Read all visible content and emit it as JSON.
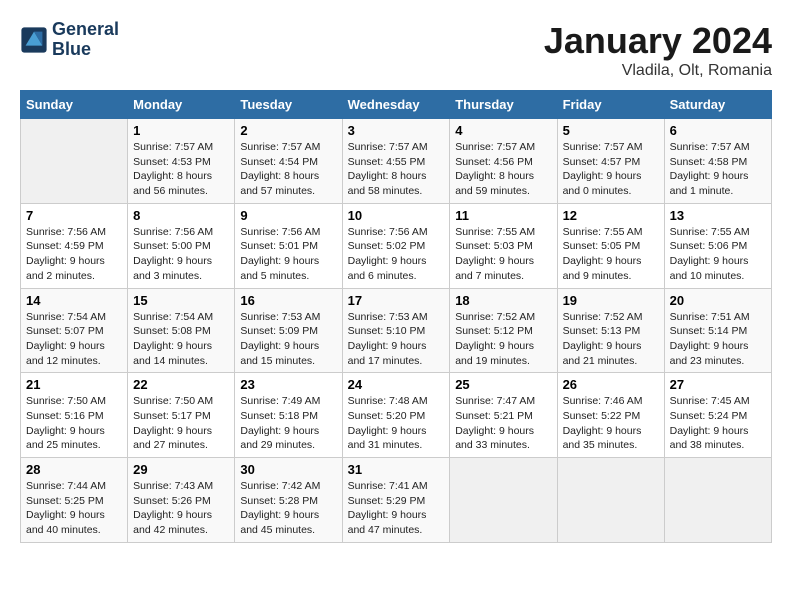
{
  "header": {
    "logo_line1": "General",
    "logo_line2": "Blue",
    "month": "January 2024",
    "location": "Vladila, Olt, Romania"
  },
  "weekdays": [
    "Sunday",
    "Monday",
    "Tuesday",
    "Wednesday",
    "Thursday",
    "Friday",
    "Saturday"
  ],
  "weeks": [
    [
      {
        "day": "",
        "info": ""
      },
      {
        "day": "1",
        "info": "Sunrise: 7:57 AM\nSunset: 4:53 PM\nDaylight: 8 hours\nand 56 minutes."
      },
      {
        "day": "2",
        "info": "Sunrise: 7:57 AM\nSunset: 4:54 PM\nDaylight: 8 hours\nand 57 minutes."
      },
      {
        "day": "3",
        "info": "Sunrise: 7:57 AM\nSunset: 4:55 PM\nDaylight: 8 hours\nand 58 minutes."
      },
      {
        "day": "4",
        "info": "Sunrise: 7:57 AM\nSunset: 4:56 PM\nDaylight: 8 hours\nand 59 minutes."
      },
      {
        "day": "5",
        "info": "Sunrise: 7:57 AM\nSunset: 4:57 PM\nDaylight: 9 hours\nand 0 minutes."
      },
      {
        "day": "6",
        "info": "Sunrise: 7:57 AM\nSunset: 4:58 PM\nDaylight: 9 hours\nand 1 minute."
      }
    ],
    [
      {
        "day": "7",
        "info": "Sunrise: 7:56 AM\nSunset: 4:59 PM\nDaylight: 9 hours\nand 2 minutes."
      },
      {
        "day": "8",
        "info": "Sunrise: 7:56 AM\nSunset: 5:00 PM\nDaylight: 9 hours\nand 3 minutes."
      },
      {
        "day": "9",
        "info": "Sunrise: 7:56 AM\nSunset: 5:01 PM\nDaylight: 9 hours\nand 5 minutes."
      },
      {
        "day": "10",
        "info": "Sunrise: 7:56 AM\nSunset: 5:02 PM\nDaylight: 9 hours\nand 6 minutes."
      },
      {
        "day": "11",
        "info": "Sunrise: 7:55 AM\nSunset: 5:03 PM\nDaylight: 9 hours\nand 7 minutes."
      },
      {
        "day": "12",
        "info": "Sunrise: 7:55 AM\nSunset: 5:05 PM\nDaylight: 9 hours\nand 9 minutes."
      },
      {
        "day": "13",
        "info": "Sunrise: 7:55 AM\nSunset: 5:06 PM\nDaylight: 9 hours\nand 10 minutes."
      }
    ],
    [
      {
        "day": "14",
        "info": "Sunrise: 7:54 AM\nSunset: 5:07 PM\nDaylight: 9 hours\nand 12 minutes."
      },
      {
        "day": "15",
        "info": "Sunrise: 7:54 AM\nSunset: 5:08 PM\nDaylight: 9 hours\nand 14 minutes."
      },
      {
        "day": "16",
        "info": "Sunrise: 7:53 AM\nSunset: 5:09 PM\nDaylight: 9 hours\nand 15 minutes."
      },
      {
        "day": "17",
        "info": "Sunrise: 7:53 AM\nSunset: 5:10 PM\nDaylight: 9 hours\nand 17 minutes."
      },
      {
        "day": "18",
        "info": "Sunrise: 7:52 AM\nSunset: 5:12 PM\nDaylight: 9 hours\nand 19 minutes."
      },
      {
        "day": "19",
        "info": "Sunrise: 7:52 AM\nSunset: 5:13 PM\nDaylight: 9 hours\nand 21 minutes."
      },
      {
        "day": "20",
        "info": "Sunrise: 7:51 AM\nSunset: 5:14 PM\nDaylight: 9 hours\nand 23 minutes."
      }
    ],
    [
      {
        "day": "21",
        "info": "Sunrise: 7:50 AM\nSunset: 5:16 PM\nDaylight: 9 hours\nand 25 minutes."
      },
      {
        "day": "22",
        "info": "Sunrise: 7:50 AM\nSunset: 5:17 PM\nDaylight: 9 hours\nand 27 minutes."
      },
      {
        "day": "23",
        "info": "Sunrise: 7:49 AM\nSunset: 5:18 PM\nDaylight: 9 hours\nand 29 minutes."
      },
      {
        "day": "24",
        "info": "Sunrise: 7:48 AM\nSunset: 5:20 PM\nDaylight: 9 hours\nand 31 minutes."
      },
      {
        "day": "25",
        "info": "Sunrise: 7:47 AM\nSunset: 5:21 PM\nDaylight: 9 hours\nand 33 minutes."
      },
      {
        "day": "26",
        "info": "Sunrise: 7:46 AM\nSunset: 5:22 PM\nDaylight: 9 hours\nand 35 minutes."
      },
      {
        "day": "27",
        "info": "Sunrise: 7:45 AM\nSunset: 5:24 PM\nDaylight: 9 hours\nand 38 minutes."
      }
    ],
    [
      {
        "day": "28",
        "info": "Sunrise: 7:44 AM\nSunset: 5:25 PM\nDaylight: 9 hours\nand 40 minutes."
      },
      {
        "day": "29",
        "info": "Sunrise: 7:43 AM\nSunset: 5:26 PM\nDaylight: 9 hours\nand 42 minutes."
      },
      {
        "day": "30",
        "info": "Sunrise: 7:42 AM\nSunset: 5:28 PM\nDaylight: 9 hours\nand 45 minutes."
      },
      {
        "day": "31",
        "info": "Sunrise: 7:41 AM\nSunset: 5:29 PM\nDaylight: 9 hours\nand 47 minutes."
      },
      {
        "day": "",
        "info": ""
      },
      {
        "day": "",
        "info": ""
      },
      {
        "day": "",
        "info": ""
      }
    ]
  ]
}
